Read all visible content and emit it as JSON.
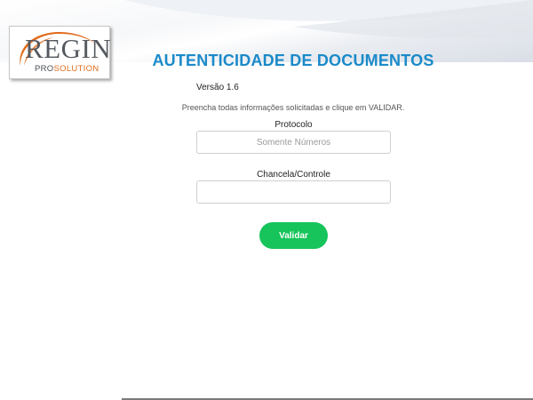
{
  "brand": {
    "logo_main": "REGIN",
    "logo_pro": "PRO",
    "logo_solution": "SOLUTION",
    "accent_orange": "#e06c1c",
    "logo_gray": "#555a60"
  },
  "page": {
    "title": "AUTENTICIDADE DE DOCUMENTOS",
    "version": "Versão 1.6",
    "instructions": "Preencha todas informações solicitadas e clique em VALIDAR.",
    "title_color": "#1b8ac9"
  },
  "form": {
    "protocolo": {
      "label": "Protocolo",
      "placeholder": "Somente Números",
      "value": ""
    },
    "chancela": {
      "label": "Chancela/Controle",
      "placeholder": "",
      "value": ""
    },
    "submit": {
      "label": "Validar",
      "color": "#17c45b"
    }
  }
}
